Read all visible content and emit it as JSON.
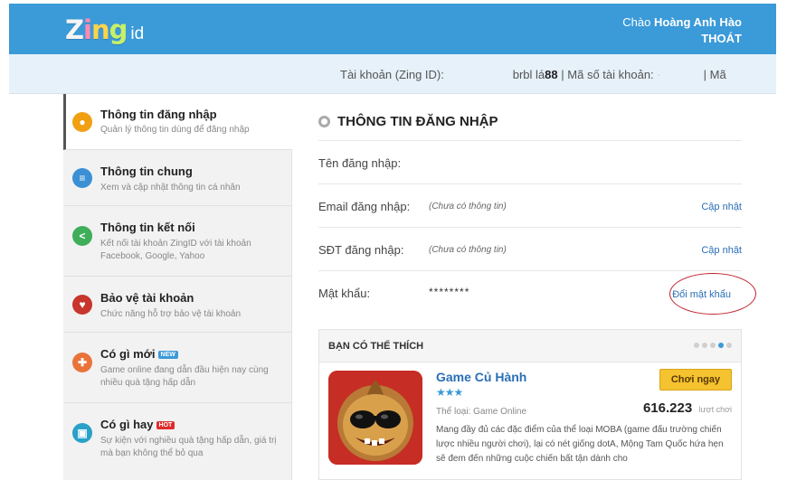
{
  "header": {
    "logo_text": "Zing",
    "logo_suffix": "id",
    "greeting_prefix": "Chào",
    "user_name": "Hoàng Anh Hào",
    "logout_label": "THOÁT"
  },
  "account_bar": {
    "account_label": "Tài khoản (Zing ID):",
    "account_value_blurred": "brbl lá",
    "account_value_suffix": "88",
    "separator": "|",
    "account_no_label": "Mã số tài khoản:",
    "account_no_value_blurred": "·",
    "trailing_separator": "|",
    "trailing_label": "Mã"
  },
  "sidebar": {
    "items": [
      {
        "title": "Thông tin đăng nhập",
        "desc": "Quản lý thông tin dùng để đăng nhập",
        "icon": "user-icon",
        "icon_color": "#f0a012",
        "icon_glyph": "●"
      },
      {
        "title": "Thông tin chung",
        "desc": "Xem và cập nhật thông tin cá nhân",
        "icon": "list-icon",
        "icon_color": "#3b8fd4",
        "icon_glyph": "≡"
      },
      {
        "title": "Thông tin kết nối",
        "desc": "Kết nối tài khoản ZingID với tài khoản Facebook, Google, Yahoo",
        "icon": "share-icon",
        "icon_color": "#3fae5a",
        "icon_glyph": "<"
      },
      {
        "title": "Bảo vệ tài khoản",
        "desc": "Chức năng hỗ trợ bảo vệ tài khoản",
        "icon": "shield-icon",
        "icon_color": "#c8352c",
        "icon_glyph": "♥"
      },
      {
        "title": "Có gì mới",
        "badge": "NEW",
        "badge_color": "#3b9ad8",
        "desc": "Game online đang dẫn đầu hiện nay cùng nhiều quà tặng hấp dẫn",
        "icon": "gamepad-icon",
        "icon_color": "#e9743a",
        "icon_glyph": "✚"
      },
      {
        "title": "Có gì hay",
        "badge": "HOT",
        "badge_color": "#e02b2b",
        "desc": "Sự kiện với nghiều quà tặng hấp dẫn, giá trị mà bạn không thể bỏ qua",
        "icon": "calendar-icon",
        "icon_color": "#2aa1c8",
        "icon_glyph": "▣"
      }
    ]
  },
  "main": {
    "title": "THÔNG TIN ĐĂNG NHẬP",
    "fields": [
      {
        "label": "Tên đăng nhập:",
        "value": "",
        "link": ""
      },
      {
        "label": "Email đăng nhập:",
        "value": "(Chưa có thông tin)",
        "link": "Cập nhật"
      },
      {
        "label": "SĐT đăng nhập:",
        "value": "(Chưa có thông tin)",
        "link": "Cập nhật"
      },
      {
        "label": "Mật khẩu:",
        "value": "********",
        "link": "Đổi mật khẩu"
      }
    ]
  },
  "suggest": {
    "title": "BẠN CÓ THỂ THÍCH",
    "active_dot": 3,
    "dot_count": 5,
    "game": {
      "name": "Game Củ Hành",
      "stars": "★★★",
      "genre": "Thể loại: Game Online",
      "play_label": "Chơi ngay",
      "plays": "616.223",
      "plays_unit": "lượt chơi",
      "description": "Mang đầy đủ các đặc điểm của thể loại MOBA (game đấu trường chiến lược nhiều người chơi), lại có nét giống dotA, Mộng Tam Quốc hứa hẹn sẽ đem đến những cuộc chiến bất tận dành cho"
    }
  },
  "colors": {
    "header_bg": "#3b9ad8",
    "link": "#2a6fb5",
    "accent_button": "#f5c230",
    "annotation_circle": "#c0242f"
  }
}
